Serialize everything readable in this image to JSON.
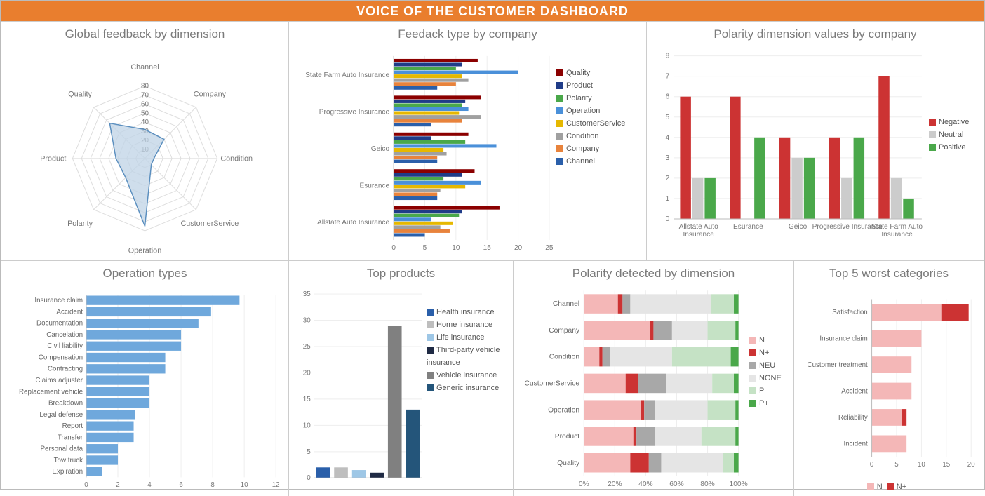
{
  "title": "VOICE OF THE CUSTOMER DASHBOARD",
  "colors": {
    "orange": "#E97E2E",
    "blueArea": "#BFD3E6",
    "blueAreaStroke": "#5B8FBF",
    "quality": "#8B0000",
    "product": "#1F3C88",
    "polarity": "#4AA84A",
    "operation": "#4A90D9",
    "custsvc": "#E6B800",
    "condition": "#A0A0A0",
    "company": "#E8833C",
    "channel": "#2A5FAA",
    "negative": "#CC3333",
    "neutral": "#CCCCCC",
    "positive": "#4AA84A",
    "hbar": "#6FA8DC",
    "health": "#2A5FAA",
    "home": "#BEBEBE",
    "life": "#9EC7E6",
    "thirdparty": "#1F2A44",
    "vehicle": "#808080",
    "generic": "#24557A",
    "N": "#F4B7B7",
    "Np": "#CC3333",
    "NEU": "#A8A8A8",
    "NONE": "#E5E5E5",
    "P": "#C5E2C5",
    "Pp": "#4AA84A"
  },
  "panels": {
    "radar": {
      "title": "Global feedback by dimension"
    },
    "feedback": {
      "title": "Feedack type by company"
    },
    "polarityCompany": {
      "title": "Polarity dimension values by company"
    },
    "operations": {
      "title": "Operation types"
    },
    "products": {
      "title": "Top products"
    },
    "polarityDim": {
      "title": "Polarity detected by dimension"
    },
    "worst": {
      "title": "Top 5 worst categories"
    }
  },
  "chart_data": [
    {
      "id": "radar",
      "type": "radar",
      "title": "Global feedback by dimension",
      "axes": [
        "Channel",
        "Company",
        "Condition",
        "CustomerService",
        "Operation",
        "Polarity",
        "Product",
        "Quality"
      ],
      "values": [
        32,
        30,
        10,
        10,
        75,
        30,
        32,
        55
      ],
      "rmax": 80,
      "rstep": 10
    },
    {
      "id": "feedback",
      "type": "bar",
      "orientation": "horizontal",
      "title": "Feedack type by company",
      "categories": [
        "State Farm Auto Insurance",
        "Progressive Insurance",
        "Geico",
        "Esurance",
        "Allstate Auto Insurance"
      ],
      "series": [
        {
          "name": "Quality",
          "color": "quality",
          "values": [
            13.5,
            14,
            12,
            13,
            17
          ]
        },
        {
          "name": "Product",
          "color": "product",
          "values": [
            11,
            11.5,
            6,
            11,
            11
          ]
        },
        {
          "name": "Polarity",
          "color": "polarity",
          "values": [
            10,
            11,
            11.5,
            8,
            10.5
          ]
        },
        {
          "name": "Operation",
          "color": "operation",
          "values": [
            20,
            12,
            16.5,
            14,
            6
          ]
        },
        {
          "name": "CustomerService",
          "color": "custsvc",
          "values": [
            11,
            10.5,
            8,
            11.5,
            9.5
          ]
        },
        {
          "name": "Condition",
          "color": "condition",
          "values": [
            12,
            14,
            8.5,
            7.5,
            7.5
          ]
        },
        {
          "name": "Company",
          "color": "company",
          "values": [
            10,
            11,
            7,
            7,
            9
          ]
        },
        {
          "name": "Channel",
          "color": "channel",
          "values": [
            7,
            6,
            7,
            7,
            5
          ]
        }
      ],
      "xmax": 25,
      "xstep": 5
    },
    {
      "id": "polarityCompany",
      "type": "bar",
      "title": "Polarity dimension values by company",
      "categories": [
        "Allstate Auto Insurance",
        "Esurance",
        "Geico",
        "Progressive Insurance",
        "State Farm Auto Insurance"
      ],
      "series": [
        {
          "name": "Negative",
          "color": "negative",
          "values": [
            6,
            6,
            4,
            4,
            7
          ]
        },
        {
          "name": "Neutral",
          "color": "neutral",
          "values": [
            2,
            0,
            3,
            2,
            2
          ]
        },
        {
          "name": "Positive",
          "color": "positive",
          "values": [
            2,
            4,
            3,
            4,
            1
          ]
        }
      ],
      "ymax": 8,
      "ystep": 1
    },
    {
      "id": "operations",
      "type": "bar",
      "orientation": "horizontal",
      "title": "Operation types",
      "categories": [
        "Insurance claim",
        "Accident",
        "Documentation",
        "Cancelation",
        "Civil liability",
        "Compensation",
        "Contracting",
        "Claims adjuster",
        "Replacement vehicle",
        "Breakdown",
        "Legal defense",
        "Report",
        "Transfer",
        "Personal data",
        "Tow truck",
        "Expiration"
      ],
      "values": [
        9.7,
        7.9,
        7.1,
        6.0,
        6.0,
        5.0,
        5.0,
        4.0,
        4.0,
        4.0,
        3.1,
        3.0,
        3.0,
        2.0,
        2.0,
        1.0
      ],
      "xmax": 12,
      "xstep": 2,
      "color": "hbar"
    },
    {
      "id": "products",
      "type": "bar",
      "title": "Top products",
      "categories": [
        "Health insurance",
        "Home insurance",
        "Life insurance",
        "Third-party vehicle insurance",
        "Vehicle insurance",
        "Generic insurance"
      ],
      "series": [
        {
          "name": "",
          "values": [
            2,
            2,
            1.5,
            1,
            29,
            13
          ]
        }
      ],
      "colors": [
        "health",
        "home",
        "life",
        "thirdparty",
        "vehicle",
        "generic"
      ],
      "ymax": 35,
      "ystep": 5
    },
    {
      "id": "polarityDim",
      "type": "stacked-bar",
      "orientation": "horizontal",
      "title": "Polarity detected by dimension",
      "categories": [
        "Channel",
        "Company",
        "Condition",
        "CustomerService",
        "Operation",
        "Product",
        "Quality"
      ],
      "series": [
        {
          "name": "N",
          "color": "N",
          "values": [
            22,
            43,
            10,
            27,
            37,
            32,
            30
          ]
        },
        {
          "name": "N+",
          "color": "Np",
          "values": [
            3,
            2,
            2,
            8,
            2,
            2,
            12
          ]
        },
        {
          "name": "NEU",
          "color": "NEU",
          "values": [
            5,
            12,
            5,
            18,
            7,
            12,
            8
          ]
        },
        {
          "name": "NONE",
          "color": "NONE",
          "values": [
            52,
            23,
            40,
            30,
            34,
            30,
            40
          ]
        },
        {
          "name": "P",
          "color": "P",
          "values": [
            15,
            18,
            38,
            14,
            18,
            22,
            7
          ]
        },
        {
          "name": "P+",
          "color": "Pp",
          "values": [
            3,
            2,
            5,
            3,
            2,
            2,
            3
          ]
        }
      ],
      "xmax": 100,
      "xstep": 20,
      "xsuffix": "%"
    },
    {
      "id": "worst",
      "type": "stacked-bar",
      "orientation": "horizontal",
      "title": "Top 5 worst categories",
      "categories": [
        "Satisfaction",
        "Insurance claim",
        "Customer treatment",
        "Accident",
        "Reliability",
        "Incident"
      ],
      "series": [
        {
          "name": "N",
          "color": "N",
          "values": [
            14,
            10,
            8,
            8,
            6,
            7
          ]
        },
        {
          "name": "N+",
          "color": "Np",
          "values": [
            5.5,
            0,
            0,
            0,
            1,
            0
          ]
        }
      ],
      "xmax": 20,
      "xstep": 5
    }
  ]
}
